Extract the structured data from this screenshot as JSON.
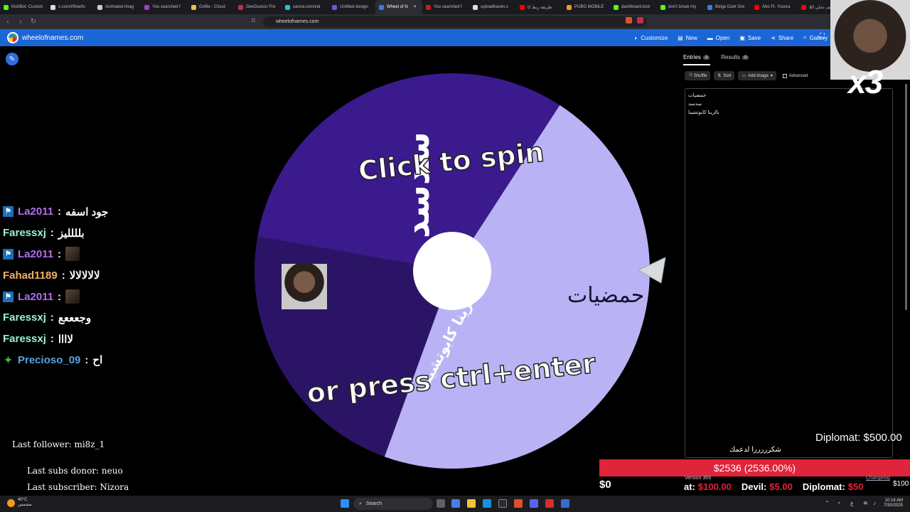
{
  "browser": {
    "tabs": [
      {
        "label": "KickBot: Custom",
        "color": "#53fc18"
      },
      {
        "label": "x.com/i/flow/lo",
        "color": "#dddddd"
      },
      {
        "label": "Animated imag",
        "color": "#cccccc"
      },
      {
        "label": "You searched f",
        "color": "#a040c0"
      },
      {
        "label": "Gofile - Cloud",
        "color": "#e6c14b"
      },
      {
        "label": "GeoGuessr Fre",
        "color": "#c0304a"
      },
      {
        "label": "canva.com/vid",
        "color": "#20c4cb"
      },
      {
        "label": "Untitled design",
        "color": "#7d4fe0"
      },
      {
        "label": "Wheel of N",
        "color": "#3b7ddd",
        "active": true
      },
      {
        "label": "You searched f",
        "color": "#c02020"
      },
      {
        "label": "uploadhaven.c",
        "color": "#dddddd"
      },
      {
        "label": "طريقة ربط كا",
        "color": "#ff0000"
      },
      {
        "label": "PUBG MOBILE",
        "color": "#e0a020"
      },
      {
        "label": "dashboard.kick",
        "color": "#53fc18"
      },
      {
        "label": "don't break my",
        "color": "#53fc18"
      },
      {
        "label": "Beige Dark Gre",
        "color": "#3b7ddd"
      },
      {
        "label": "Abo Ft. Yousra",
        "color": "#ff0000"
      },
      {
        "label": "كيف تخلي اللا",
        "color": "#ff0000"
      }
    ],
    "url": "wheelofnames.com"
  },
  "app": {
    "site_name": "wheelofnames.com",
    "menu": [
      {
        "label": "Customize",
        "icon": "palette-icon",
        "glyph": "◐"
      },
      {
        "label": "New",
        "icon": "file-icon",
        "glyph": "▤"
      },
      {
        "label": "Open",
        "icon": "folder-icon",
        "glyph": "▬"
      },
      {
        "label": "Save",
        "icon": "save-icon",
        "glyph": "▣"
      },
      {
        "label": "Share",
        "icon": "share-icon",
        "glyph": "⋖"
      },
      {
        "label": "Gallery",
        "icon": "search-icon",
        "glyph": "⌕"
      }
    ]
  },
  "wheel": {
    "prompt_line1": "Click to spin",
    "prompt_line2": "or press ctrl+enter",
    "segments": [
      {
        "label": "سدسد",
        "color": "#3a1a8c"
      },
      {
        "label": "بالرينا كابوتشينا",
        "color": "#2b1466"
      },
      {
        "label": "حمضيات",
        "color": "#b9b3f5"
      }
    ]
  },
  "panel": {
    "tab_entries": "Entries",
    "entries_count": "3",
    "tab_results": "Results",
    "results_count": "0",
    "shuffle": "Shuffle",
    "sort": "Sort",
    "add_image": "Add image",
    "advanced": "Advanced",
    "entries": [
      "حمضيات",
      "سدسد",
      "بالرينا كابوتشينا"
    ]
  },
  "chat": [
    {
      "user": "La2011",
      "msg": "جود اسفه",
      "color": "#b36cf0",
      "badge": "sub"
    },
    {
      "user": "Faressxj",
      "msg": "بلللليز",
      "color": "#9af0d8",
      "badge": "none"
    },
    {
      "user": "La2011",
      "msg": "",
      "color": "#b36cf0",
      "badge": "sub",
      "emote": true
    },
    {
      "user": "Fahad1189",
      "msg": "لالالالالا",
      "color": "#f0b26c",
      "badge": "none"
    },
    {
      "user": "La2011",
      "msg": "",
      "color": "#b36cf0",
      "badge": "sub",
      "emote": true
    },
    {
      "user": "Faressxj",
      "msg": "وجعععع",
      "color": "#9af0d8",
      "badge": "none"
    },
    {
      "user": "Faressxj",
      "msg": "لاااا",
      "color": "#9af0d8",
      "badge": "none"
    },
    {
      "user": "Precioso_09",
      "msg": "اح",
      "color": "#5aa0e0",
      "badge": "gem"
    }
  ],
  "overlay": {
    "last_follower": "Last follower: mi8z_1",
    "last_donor": "Last subs donor: neuo",
    "last_subscriber": "Last subscriber: Nizora",
    "diplomat_top": "Diplomat: $500.00",
    "thanks": "شكرررررا لدعمك",
    "goal": "$2536 (2536.00%)",
    "zero": "$0",
    "version": "Version 369",
    "changelog": "Changelog",
    "amount_100": "$100",
    "prices": [
      {
        "label": "at:",
        "value": "$100.00"
      },
      {
        "label": "Devil:",
        "value": "$5.00"
      },
      {
        "label": "Diplomat:",
        "value": "$50"
      }
    ],
    "multiplier": "x3"
  },
  "taskbar": {
    "weather_temp": "40°C",
    "weather_desc": "مشمس",
    "search": "Search",
    "time": "10:16 AM",
    "date": "7/30/2025"
  }
}
